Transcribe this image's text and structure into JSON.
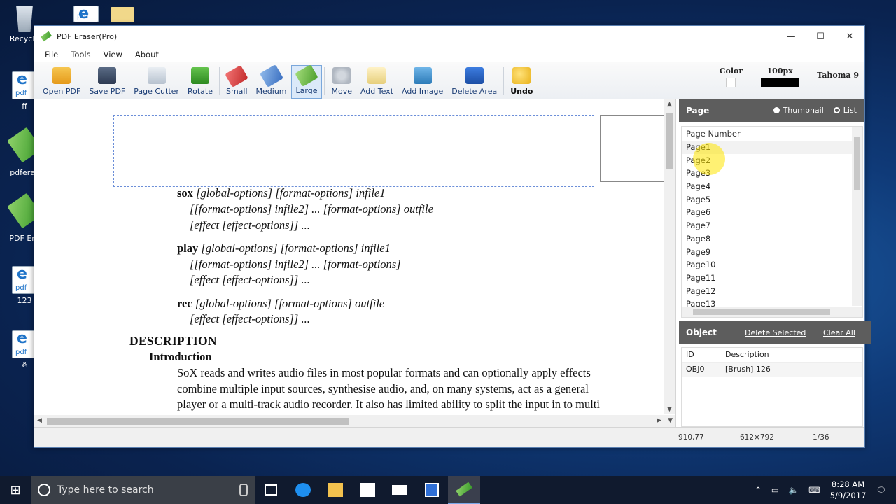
{
  "desktop": {
    "icons": [
      {
        "label": "Recycle"
      },
      {
        "label": "ff"
      },
      {
        "label": "pdferas"
      },
      {
        "label": "PDF Era"
      },
      {
        "label": "123"
      },
      {
        "label": "ë"
      }
    ]
  },
  "window": {
    "title": "PDF Eraser(Pro)",
    "controls": {
      "minimize": "—",
      "maximize": "☐",
      "close": "✕"
    }
  },
  "menu": [
    "File",
    "Tools",
    "View",
    "About"
  ],
  "toolbar": {
    "buttons": [
      {
        "label": "Open PDF",
        "icon": "open-pdf-icon"
      },
      {
        "label": "Save PDF",
        "icon": "save-icon"
      },
      {
        "label": "Page Cutter",
        "icon": "page-cutter-icon"
      },
      {
        "label": "Rotate",
        "icon": "rotate-icon"
      },
      {
        "label": "Small",
        "icon": "small-eraser-icon"
      },
      {
        "label": "Medium",
        "icon": "medium-eraser-icon"
      },
      {
        "label": "Large",
        "icon": "large-eraser-icon"
      },
      {
        "label": "Move",
        "icon": "move-icon"
      },
      {
        "label": "Add Text",
        "icon": "add-text-icon"
      },
      {
        "label": "Add Image",
        "icon": "add-image-icon"
      },
      {
        "label": "Delete Area",
        "icon": "delete-area-icon"
      },
      {
        "label": "Undo",
        "icon": "undo-icon"
      }
    ],
    "active": "Large",
    "color_label": "Color",
    "color_value": "#ffffff",
    "size_label": "100px",
    "font_label": "Tahoma 9"
  },
  "document": {
    "lines": [
      {
        "cmd": "sox",
        "rest": " [global-options] [format-options] infile1"
      },
      {
        "cmd": "",
        "rest": "[[format-options] infile2] ... [format-options] outfile"
      },
      {
        "cmd": "",
        "rest": "[effect [effect-options]] ..."
      },
      {
        "cmd": "play",
        "rest": " [global-options] [format-options] infile1"
      },
      {
        "cmd": "",
        "rest": "[[format-options] infile2] ... [format-options]"
      },
      {
        "cmd": "",
        "rest": "[effect [effect-options]] ..."
      },
      {
        "cmd": "rec",
        "rest": " [global-options] [format-options] outfile"
      },
      {
        "cmd": "",
        "rest": "[effect [effect-options]] ..."
      }
    ],
    "heading": "DESCRIPTION",
    "subheading": "Introduction",
    "paragraph": [
      "SoX reads and writes audio files in most popular formats and can optionally apply effects",
      "combine multiple input sources, synthesise audio, and, on many systems, act as a general",
      "player or a multi-track audio recorder. It also has limited ability to split the input in to multi"
    ]
  },
  "page_panel": {
    "title": "Page",
    "view_options": [
      "Thumbnail",
      "List"
    ],
    "selected_view": "List",
    "column_header": "Page Number",
    "pages": [
      "Page1",
      "Page2",
      "Page3",
      "Page4",
      "Page5",
      "Page6",
      "Page7",
      "Page8",
      "Page9",
      "Page10",
      "Page11",
      "Page12",
      "Page13"
    ]
  },
  "object_panel": {
    "title": "Object",
    "delete_selected": "Delete Selected",
    "clear_all": "Clear All",
    "columns": [
      "ID",
      "Description"
    ],
    "rows": [
      {
        "id": "OBJ0",
        "description": "[Brush] 126"
      }
    ]
  },
  "status": {
    "coords": "910,77",
    "page_size": "612×792",
    "page_index": "1/36"
  },
  "taskbar": {
    "search_placeholder": "Type here to search",
    "time": "8:28 AM",
    "date": "5/9/2017"
  }
}
